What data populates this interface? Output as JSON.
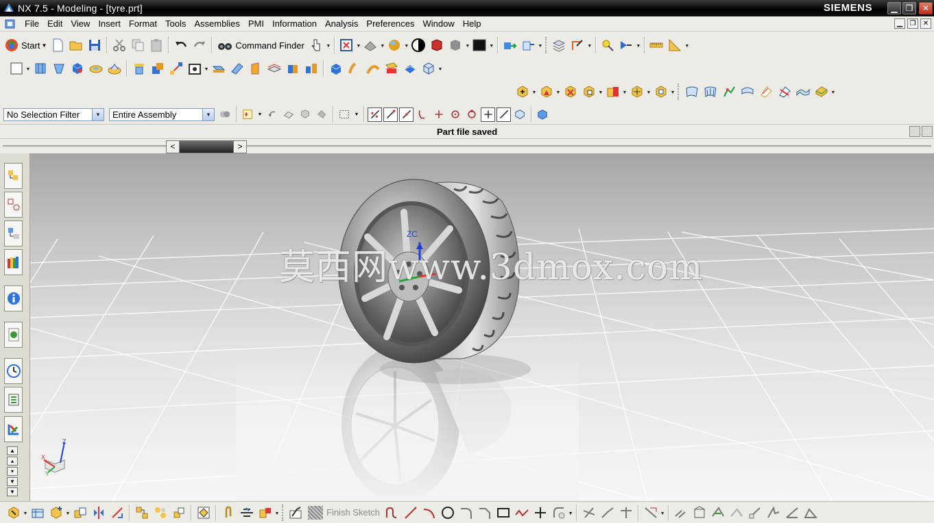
{
  "window": {
    "title": "NX 7.5 - Modeling - [tyre.prt]",
    "brand": "SIEMENS",
    "minimize_glyph": "▁",
    "restore_glyph": "❐",
    "close_glyph": "✕"
  },
  "menubar": {
    "items": [
      {
        "label": "File"
      },
      {
        "label": "Edit"
      },
      {
        "label": "View"
      },
      {
        "label": "Insert"
      },
      {
        "label": "Format"
      },
      {
        "label": "Tools"
      },
      {
        "label": "Assemblies"
      },
      {
        "label": "PMI"
      },
      {
        "label": "Information"
      },
      {
        "label": "Analysis"
      },
      {
        "label": "Preferences"
      },
      {
        "label": "Window"
      },
      {
        "label": "Help"
      }
    ],
    "mdi_minimize": "▁",
    "mdi_restore": "❐",
    "mdi_close": "✕"
  },
  "standard_toolbar": {
    "start_label": "Start",
    "command_finder_label": "Command Finder"
  },
  "selection_bar": {
    "filter_value": "No Selection Filter",
    "scope_value": "Entire Assembly"
  },
  "cue_line": {
    "status": "Part file saved"
  },
  "graphics": {
    "watermark": "莫西网www.3dmox.com",
    "wcs_label": "ZC",
    "triad_axes": {
      "x": "X",
      "y": "Y",
      "z": "Z"
    }
  },
  "sketch_toolbar": {
    "finish_sketch_label": "Finish Sketch"
  },
  "colors": {
    "title_bar": "#000000",
    "toolbar_bg": "#ecebe6",
    "accent_orange": "#f0a020",
    "accent_blue": "#2f6fd8"
  }
}
